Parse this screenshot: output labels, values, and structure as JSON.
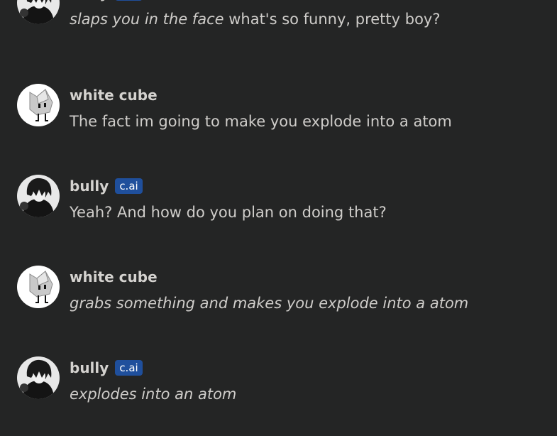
{
  "badge_label": "c.ai",
  "messages": [
    {
      "author": "bully",
      "avatar_icon": "bully-avatar-icon",
      "action": "slaps you in the face",
      "text": " what's so funny, pretty boy?"
    },
    {
      "author": "white cube",
      "avatar_icon": "white-cube-avatar-icon",
      "text": "The fact im going to make you explode into a atom"
    },
    {
      "author": "bully",
      "avatar_icon": "bully-avatar-icon",
      "text": "Yeah? And how do you plan on doing that?"
    },
    {
      "author": "white cube",
      "avatar_icon": "white-cube-avatar-icon",
      "action": "grabs something and makes you explode into a atom"
    },
    {
      "author": "bully",
      "avatar_icon": "bully-avatar-icon",
      "action": "explodes into an atom"
    }
  ],
  "colors": {
    "background": "#242525",
    "name": "#d4d2cf",
    "text": "#cfcdca",
    "badge": "#1f4f9c"
  }
}
